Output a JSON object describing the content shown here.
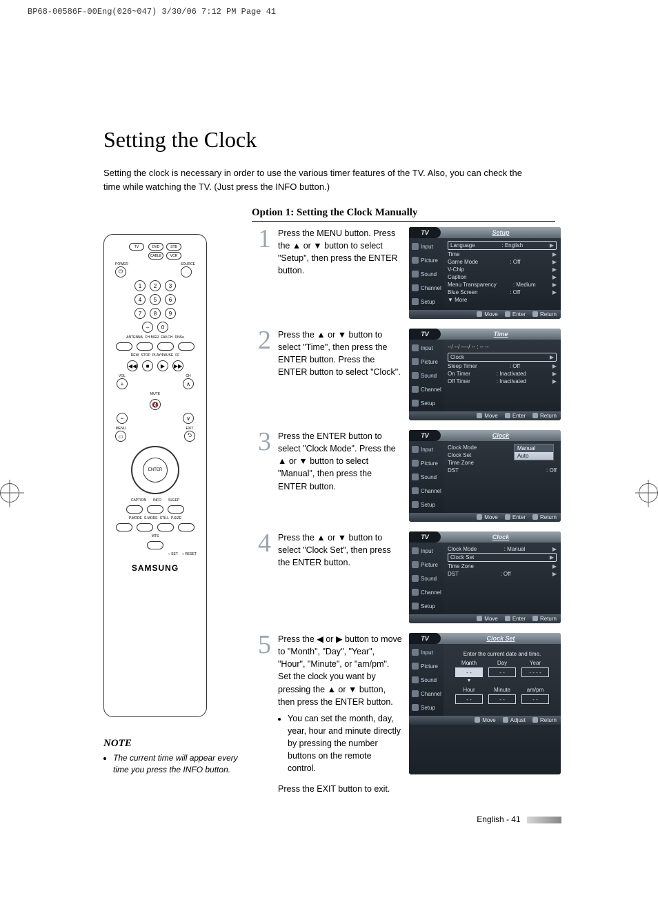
{
  "print_header": "BP68-00586F-00Eng(026~047)  3/30/06  7:12 PM  Page 41",
  "title": "Setting the Clock",
  "intro": "Setting the clock is necessary in order to use the various timer features of the TV. Also, you can check the time while watching the TV. (Just press the INFO button.)",
  "section_heading": "Option 1: Setting the Clock Manually",
  "remote": {
    "mode_buttons": [
      "TV",
      "DVD",
      "STB",
      "CABLE",
      "VCR"
    ],
    "power_label": "POWER",
    "source_label": "SOURCE",
    "misc_row": [
      "ANTENNA",
      "CH MGR",
      "FAV.CH",
      "DNSe"
    ],
    "transport_row": [
      "REW",
      "STOP",
      "PLAY/PAUSE",
      "FF"
    ],
    "vol_label": "VOL",
    "ch_label": "CH",
    "mute_label": "MUTE",
    "menu_label": "MENU",
    "exit_label": "EXIT",
    "enter_label": "ENTER",
    "bottom_row1": [
      "CAPTION",
      "INFO",
      "SLEEP"
    ],
    "bottom_row2": [
      "P.MODE",
      "S.MODE",
      "STILL",
      "P.SIZE"
    ],
    "mts_label": "MTS",
    "set_label": "○ SET",
    "reset_label": "○ RESET",
    "brand": "SAMSUNG"
  },
  "note": {
    "heading": "NOTE",
    "items": [
      "The current time will appear every time you press the INFO button."
    ]
  },
  "steps": [
    {
      "num": "1",
      "text": "Press the MENU button. Press the ▲ or ▼ button to select \"Setup\", then press the ENTER button.",
      "osd": {
        "title": "Setup",
        "tabs": [
          "Input",
          "Picture",
          "Sound",
          "Channel",
          "Setup"
        ],
        "rows": [
          {
            "label": "Language",
            "value": ": English",
            "boxed": true,
            "arrow": true
          },
          {
            "label": "Time",
            "arrow": true
          },
          {
            "label": "Game Mode",
            "value": ": Off",
            "arrow": true
          },
          {
            "label": "V-Chip",
            "arrow": true
          },
          {
            "label": "Caption",
            "arrow": true
          },
          {
            "label": "Menu Transparency",
            "value": ": Medium",
            "arrow": true
          },
          {
            "label": "Blue Screen",
            "value": ": Off",
            "arrow": true
          },
          {
            "label": "▼ More"
          }
        ],
        "foot": [
          "Move",
          "Enter",
          "Return"
        ]
      }
    },
    {
      "num": "2",
      "text": "Press the ▲ or ▼ button to select \"Time\", then press the ENTER button. Press the ENTER button to select \"Clock\".",
      "osd": {
        "title": "Time",
        "tabs": [
          "Input",
          "Picture",
          "Sound",
          "Channel",
          "Setup"
        ],
        "pretext": "--/ --/ ----/ -- : -- --",
        "rows": [
          {
            "label": "Clock",
            "boxed": true,
            "arrow": true
          },
          {
            "label": "Sleep Timer",
            "value": ": Off",
            "arrow": true
          },
          {
            "label": "On Timer",
            "value": ": Inactivated",
            "arrow": true
          },
          {
            "label": "Off Timer",
            "value": ": Inactivated",
            "arrow": true
          }
        ],
        "foot": [
          "Move",
          "Enter",
          "Return"
        ]
      }
    },
    {
      "num": "3",
      "text": "Press the ENTER button to select \"Clock Mode\". Press the ▲ or ▼ button to select \"Manual\", then press the ENTER button.",
      "osd": {
        "title": "Clock",
        "tabs": [
          "Input",
          "Picture",
          "Sound",
          "Channel",
          "Setup"
        ],
        "rows": [
          {
            "label": "Clock Mode",
            "dropdown": [
              "Manual",
              "Auto"
            ]
          },
          {
            "label": "Clock Set"
          },
          {
            "label": "Time Zone"
          },
          {
            "label": "DST",
            "value": ": Off"
          }
        ],
        "foot": [
          "Move",
          "Enter",
          "Return"
        ]
      }
    },
    {
      "num": "4",
      "text": "Press the ▲ or ▼ button to select \"Clock Set\", then press the ENTER button.",
      "osd": {
        "title": "Clock",
        "tabs": [
          "Input",
          "Picture",
          "Sound",
          "Channel",
          "Setup"
        ],
        "rows": [
          {
            "label": "Clock Mode",
            "value": ": Manual",
            "arrow": true
          },
          {
            "label": "Clock Set",
            "boxed": true,
            "arrow": true
          },
          {
            "label": "Time Zone",
            "arrow": true
          },
          {
            "label": "DST",
            "value": ": Off",
            "arrow": true
          }
        ],
        "foot": [
          "Move",
          "Enter",
          "Return"
        ]
      }
    },
    {
      "num": "5",
      "text": "Press the ◀ or ▶ button to move to \"Month\", \"Day\", \"Year\", \"Hour\", \"Minute\", or \"am/pm\". Set the clock you want by pressing the ▲ or ▼ button, then press the ENTER button.",
      "bullets": [
        "You can set the month, day, year, hour and minute directly by pressing the number buttons on the remote control."
      ],
      "osd": {
        "title": "Clock Set",
        "tabs": [
          "Input",
          "Picture",
          "Sound",
          "Channel",
          "Setup"
        ],
        "clockset": {
          "hint": "Enter the current date and time.",
          "cols1": [
            "Month",
            "Day",
            "Year"
          ],
          "vals1": [
            "- -",
            "- -",
            "- - - -"
          ],
          "cols2": [
            "Hour",
            "Minute",
            "am/pm"
          ],
          "vals2": [
            "- -",
            "- -",
            "- -"
          ]
        },
        "foot": [
          "Move",
          "Adjust",
          "Return"
        ]
      }
    }
  ],
  "final_line": "Press the EXIT button to exit.",
  "footer": "English - 41"
}
